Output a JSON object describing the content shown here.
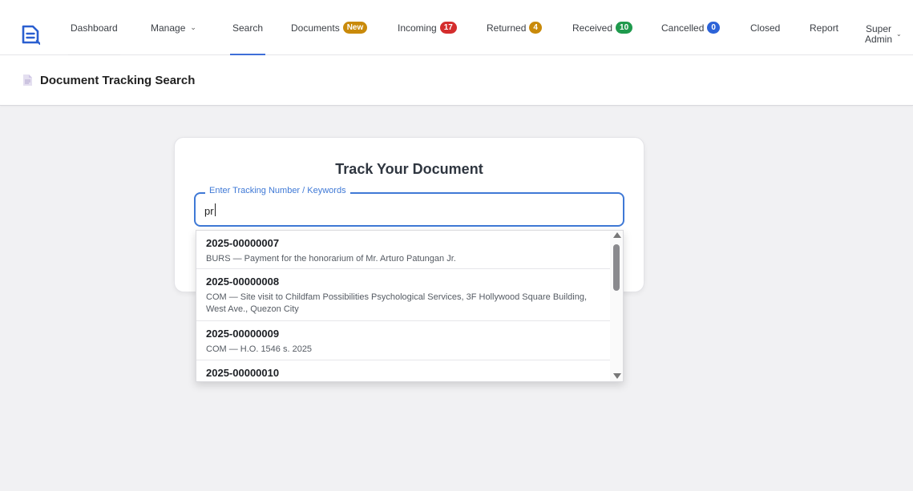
{
  "nav": {
    "items": [
      {
        "label": "Dashboard"
      },
      {
        "label": "Manage"
      },
      {
        "label": "Search"
      },
      {
        "label": "Documents",
        "badge": "New",
        "badge_color": "#c98a0a"
      },
      {
        "label": "Incoming",
        "badge": "17",
        "badge_color": "#d42d2d"
      },
      {
        "label": "Returned",
        "badge": "4",
        "badge_color": "#c98a0a"
      },
      {
        "label": "Received",
        "badge": "10",
        "badge_color": "#1f9a4d"
      },
      {
        "label": "Cancelled",
        "badge": "0",
        "badge_color": "#2c63d8"
      },
      {
        "label": "Closed"
      },
      {
        "label": "Report"
      }
    ],
    "user_line1": "Super",
    "user_line2": "Admin",
    "active_color": "#3e6fd8"
  },
  "page": {
    "title": "Document Tracking Search"
  },
  "card": {
    "title": "Track Your Document",
    "field_label": "Enter Tracking Number / Keywords",
    "field_value": "pr"
  },
  "results": [
    {
      "number": "2025-00000007",
      "desc": "BURS — Payment for the honorarium of Mr. Arturo Patungan Jr."
    },
    {
      "number": "2025-00000008",
      "desc": "COM — Site visit to Childfam Possibilities Psychological Services, 3F Hollywood Square Building, West Ave., Quezon City"
    },
    {
      "number": "2025-00000009",
      "desc": "COM — H.O. 1546 s. 2025"
    },
    {
      "number": "2025-00000010",
      "desc": ""
    }
  ]
}
